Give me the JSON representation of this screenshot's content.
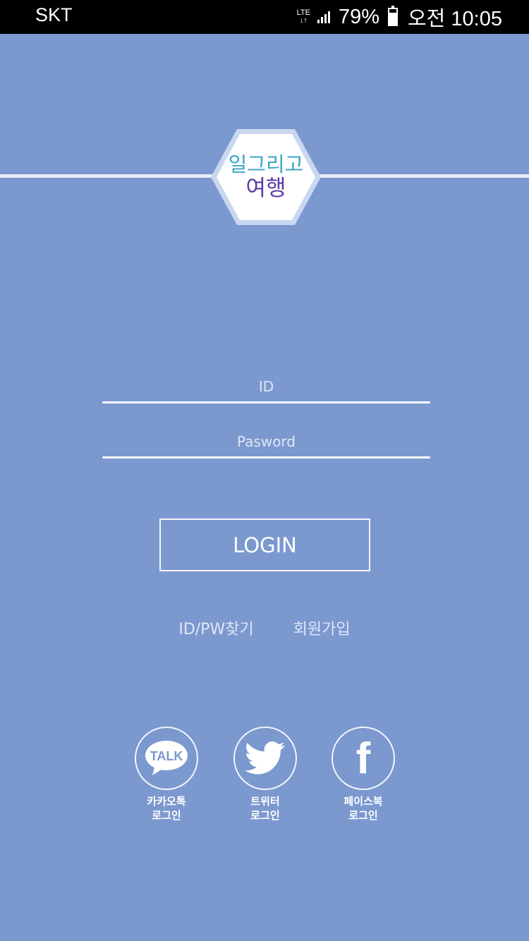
{
  "status_bar": {
    "carrier": "SKT",
    "network": "LTE",
    "battery_percent": "79%",
    "battery_level": 0.79,
    "time": "오전 10:05"
  },
  "logo": {
    "line1": "일그리고",
    "line2": "여행"
  },
  "form": {
    "id_placeholder": "ID",
    "password_placeholder": "Pasword",
    "login_label": "LOGIN"
  },
  "links": {
    "find_account": "ID/PW찾기",
    "signup": "회원가입"
  },
  "social": [
    {
      "icon": "kakaotalk-icon",
      "icon_text": "TALK",
      "label_line1": "카카오톡",
      "label_line2": "로그인"
    },
    {
      "icon": "twitter-icon",
      "label_line1": "트위터",
      "label_line2": "로그인"
    },
    {
      "icon": "facebook-icon",
      "icon_text": "f",
      "label_line1": "페이스북",
      "label_line2": "로그인"
    }
  ],
  "colors": {
    "background": "#7b98cf",
    "status_bar": "#000000",
    "logo_cyan": "#3aa7c7",
    "logo_purple": "#5a3aa5"
  }
}
